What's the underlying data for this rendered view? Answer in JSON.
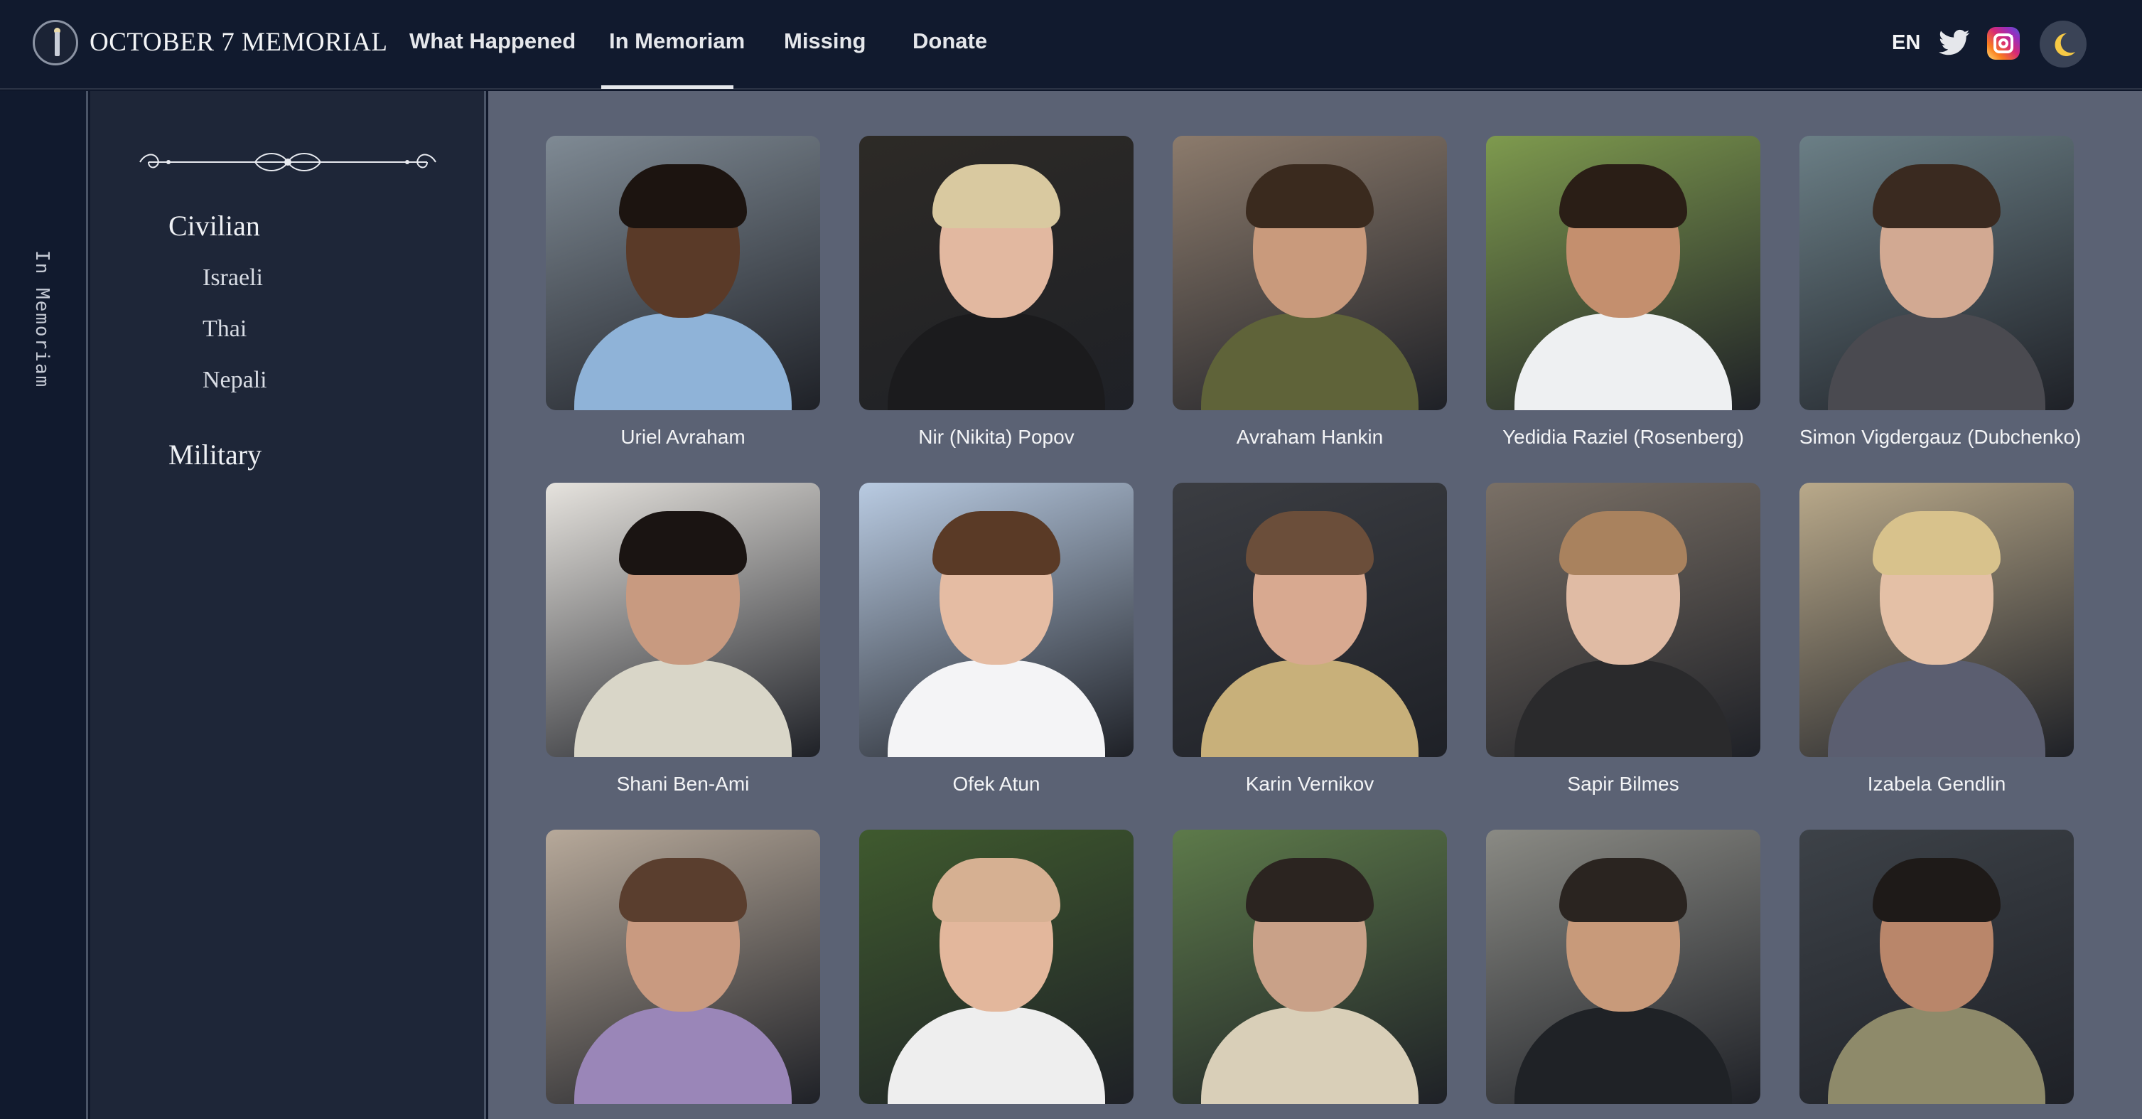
{
  "brand": {
    "title": "OCTOBER 7 MEMORIAL"
  },
  "nav": {
    "links": [
      "What Happened",
      "In Memoriam",
      "Missing",
      "Donate"
    ],
    "active": "In Memoriam",
    "lang": "EN"
  },
  "rail": {
    "label": "In Memoriam"
  },
  "sidebar": {
    "categories": [
      {
        "label": "Civilian",
        "items": [
          "Israeli",
          "Thai",
          "Nepali"
        ]
      },
      {
        "label": "Military",
        "items": []
      }
    ]
  },
  "people": [
    {
      "name": "Uriel Avraham",
      "bg": "#7f8a94",
      "skin": "#5a3a28",
      "hair": "#1c1410",
      "shirt": "#8fb3d8"
    },
    {
      "name": "Nir (Nikita) Popov",
      "bg": "#2d2a26",
      "skin": "#e2b8a0",
      "hair": "#d9c9a0",
      "shirt": "#1b1b1d"
    },
    {
      "name": "Avraham Hankin",
      "bg": "#8c7b6c",
      "skin": "#c99a7c",
      "hair": "#3a2a1e",
      "shirt": "#5f6339"
    },
    {
      "name": "Yedidia Raziel (Rosenberg)",
      "bg": "#7e9a4e",
      "skin": "#c48f6e",
      "hair": "#2a1e16",
      "shirt": "#eef0f2"
    },
    {
      "name": "Simon Vigdergauz (Dubchenko)",
      "bg": "#6b7f86",
      "skin": "#d2a992",
      "hair": "#3a2a20",
      "shirt": "#4a4a50"
    },
    {
      "name": "Shani Ben-Ami",
      "bg": "#e6e3de",
      "skin": "#c89a80",
      "hair": "#1a1412",
      "shirt": "#d9d6c8"
    },
    {
      "name": "Ofek Atun",
      "bg": "#b9cbe2",
      "skin": "#e5bca3",
      "hair": "#5a3a26",
      "shirt": "#f4f4f6"
    },
    {
      "name": "Karin Vernikov",
      "bg": "#3b3d42",
      "skin": "#d8a990",
      "hair": "#6b4e3a",
      "shirt": "#c8b07a"
    },
    {
      "name": "Sapir Bilmes",
      "bg": "#7a7066",
      "skin": "#e0bba4",
      "hair": "#a9825e",
      "shirt": "#2a2a2c"
    },
    {
      "name": "Izabela Gendlin",
      "bg": "#b9a98a",
      "skin": "#e4c0a6",
      "hair": "#d8c28c",
      "shirt": "#5b5e70"
    },
    {
      "name": "",
      "bg": "#b7a99a",
      "skin": "#c99a80",
      "hair": "#5a3e2e",
      "shirt": "#9a86b8"
    },
    {
      "name": "",
      "bg": "#3f5a2e",
      "skin": "#e3b79c",
      "hair": "#d6b092",
      "shirt": "#eeeeee"
    },
    {
      "name": "",
      "bg": "#5d7a4a",
      "skin": "#c9a188",
      "hair": "#2b2420",
      "shirt": "#d9cfb8"
    },
    {
      "name": "",
      "bg": "#8a8a84",
      "skin": "#c89a7a",
      "hair": "#2a2420",
      "shirt": "#1f2226"
    },
    {
      "name": "",
      "bg": "#3d4248",
      "skin": "#b9866a",
      "hair": "#1e1a18",
      "shirt": "#8e8a6a"
    }
  ]
}
